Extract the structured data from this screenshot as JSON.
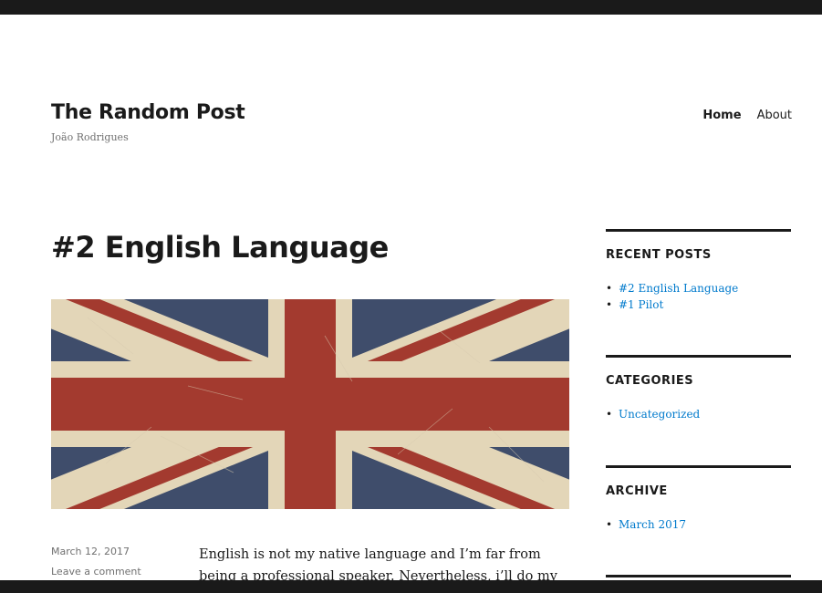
{
  "site": {
    "title": "The Random Post",
    "description": "João Rodrigues"
  },
  "nav": {
    "items": [
      {
        "label": "Home",
        "current": true
      },
      {
        "label": "About",
        "current": false
      }
    ]
  },
  "post": {
    "title": "#2 English Language",
    "featured_image": "flag-image-union-jack",
    "date": "March 12, 2017",
    "comments": "Leave a comment",
    "content": "English is not my native language and I’m far from being a professional speaker. Nevertheless, i’ll do my best, with the"
  },
  "sidebar": {
    "widgets": [
      {
        "title": "RECENT POSTS",
        "items": [
          "#2 English Language",
          "#1 Pilot"
        ]
      },
      {
        "title": "CATEGORIES",
        "items": [
          "Uncategorized"
        ]
      },
      {
        "title": "ARCHIVE",
        "items": [
          "March 2017"
        ]
      }
    ]
  },
  "colors": {
    "link": "#007acc",
    "text": "#1a1a1a",
    "meta": "#707070",
    "frame": "#1a1a1a",
    "flag_red": "#a33a2f",
    "flag_blue": "#3f4d6b",
    "flag_cream": "#e3d6b8"
  }
}
